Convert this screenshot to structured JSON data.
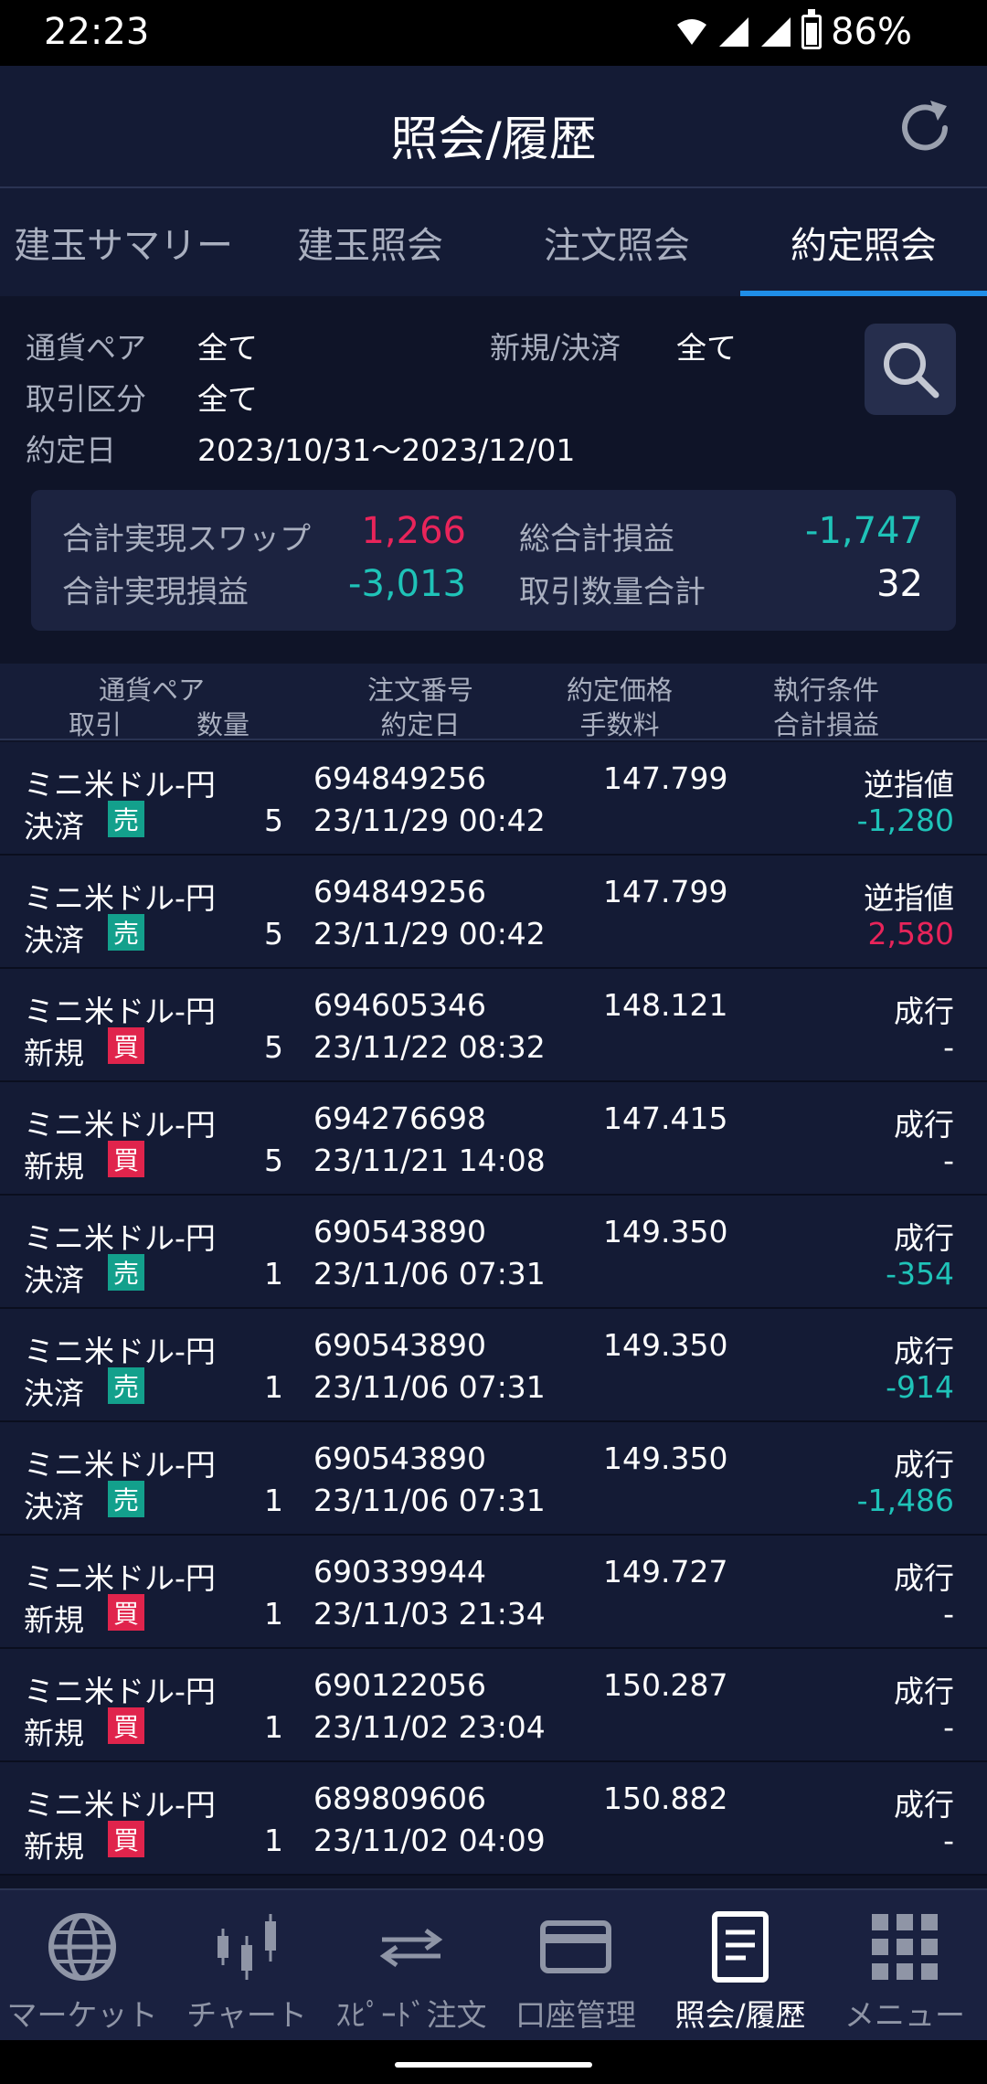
{
  "status_bar": {
    "time": "22:23",
    "battery": "86%"
  },
  "header": {
    "title": "照会/履歴"
  },
  "tabs": [
    {
      "label": "建玉サマリー"
    },
    {
      "label": "建玉照会"
    },
    {
      "label": "注文照会"
    },
    {
      "label": "約定照会",
      "active": true
    }
  ],
  "filters": {
    "pair_label": "通貨ペア",
    "pair_value": "全て",
    "newclose_label": "新規/決済",
    "newclose_value": "全て",
    "type_label": "取引区分",
    "type_value": "全て",
    "date_label": "約定日",
    "date_value": "2023/10/31～2023/12/01"
  },
  "summary": {
    "swap_label": "合計実現スワップ",
    "swap_value": "1,266",
    "total_pl_label": "総合計損益",
    "total_pl_value": "-1,747",
    "realized_label": "合計実現損益",
    "realized_value": "-3,013",
    "qty_label": "取引数量合計",
    "qty_value": "32"
  },
  "table_headers": {
    "pair": "通貨ペア",
    "trade": "取引",
    "qty": "数量",
    "order_no": "注文番号",
    "exec_date": "約定日",
    "price": "約定価格",
    "fee": "手数料",
    "condition": "執行条件",
    "total_pl": "合計損益"
  },
  "rows": [
    {
      "pair": "ミニ米ドル-円",
      "kind": "決済",
      "side": "売",
      "qty": "5",
      "order": "694849256",
      "date": "23/11/29 00:42",
      "price": "147.799",
      "cond": "逆指値",
      "pl": "-1,280"
    },
    {
      "pair": "ミニ米ドル-円",
      "kind": "決済",
      "side": "売",
      "qty": "5",
      "order": "694849256",
      "date": "23/11/29 00:42",
      "price": "147.799",
      "cond": "逆指値",
      "pl": "2,580"
    },
    {
      "pair": "ミニ米ドル-円",
      "kind": "新規",
      "side": "買",
      "qty": "5",
      "order": "694605346",
      "date": "23/11/22 08:32",
      "price": "148.121",
      "cond": "成行",
      "pl": "-"
    },
    {
      "pair": "ミニ米ドル-円",
      "kind": "新規",
      "side": "買",
      "qty": "5",
      "order": "694276698",
      "date": "23/11/21 14:08",
      "price": "147.415",
      "cond": "成行",
      "pl": "-"
    },
    {
      "pair": "ミニ米ドル-円",
      "kind": "決済",
      "side": "売",
      "qty": "1",
      "order": "690543890",
      "date": "23/11/06 07:31",
      "price": "149.350",
      "cond": "成行",
      "pl": "-354"
    },
    {
      "pair": "ミニ米ドル-円",
      "kind": "決済",
      "side": "売",
      "qty": "1",
      "order": "690543890",
      "date": "23/11/06 07:31",
      "price": "149.350",
      "cond": "成行",
      "pl": "-914"
    },
    {
      "pair": "ミニ米ドル-円",
      "kind": "決済",
      "side": "売",
      "qty": "1",
      "order": "690543890",
      "date": "23/11/06 07:31",
      "price": "149.350",
      "cond": "成行",
      "pl": "-1,486"
    },
    {
      "pair": "ミニ米ドル-円",
      "kind": "新規",
      "side": "買",
      "qty": "1",
      "order": "690339944",
      "date": "23/11/03 21:34",
      "price": "149.727",
      "cond": "成行",
      "pl": "-"
    },
    {
      "pair": "ミニ米ドル-円",
      "kind": "新規",
      "side": "買",
      "qty": "1",
      "order": "690122056",
      "date": "23/11/02 23:04",
      "price": "150.287",
      "cond": "成行",
      "pl": "-"
    },
    {
      "pair": "ミニ米ドル-円",
      "kind": "新規",
      "side": "買",
      "qty": "1",
      "order": "689809606",
      "date": "23/11/02 04:09",
      "price": "150.882",
      "cond": "成行",
      "pl": "-"
    }
  ],
  "bottom_nav": [
    {
      "label": "マーケット",
      "icon": "globe-icon"
    },
    {
      "label": "チャート",
      "icon": "candlestick-icon"
    },
    {
      "label": "ｽﾋﾟｰﾄﾞ注文",
      "icon": "swap-arrows-icon"
    },
    {
      "label": "口座管理",
      "icon": "card-icon"
    },
    {
      "label": "照会/履歴",
      "icon": "document-icon",
      "active": true
    },
    {
      "label": "メニュー",
      "icon": "grid-icon"
    }
  ],
  "colors": {
    "positive": "#e8245a",
    "negative": "#1fc3b8",
    "sell_badge": "#13a08c",
    "buy_badge": "#e0244c",
    "active_tab": "#1f8ee8"
  }
}
